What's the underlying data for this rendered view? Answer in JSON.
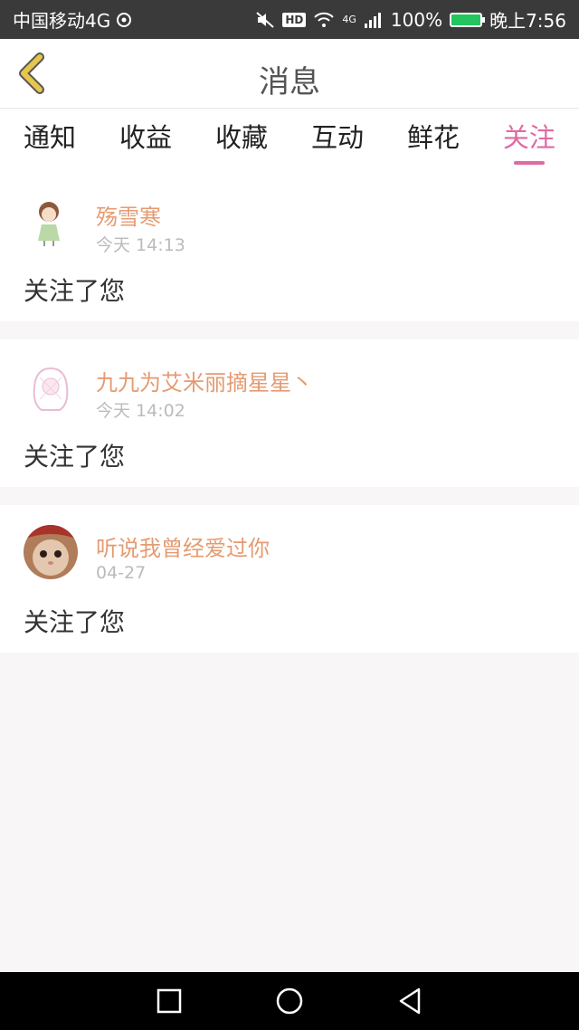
{
  "statusbar": {
    "carrier": "中国移动4G",
    "signal_tag": "4G",
    "battery": "100%",
    "time": "晚上7:56",
    "hd": "HD"
  },
  "header": {
    "title": "消息"
  },
  "tabs": [
    {
      "label": "通知"
    },
    {
      "label": "收益"
    },
    {
      "label": "收藏"
    },
    {
      "label": "互动"
    },
    {
      "label": "鲜花"
    },
    {
      "label": "关注"
    }
  ],
  "active_tab": "关注",
  "messages": [
    {
      "name": "殇雪寒",
      "time": "今天 14:13",
      "text": "关注了您"
    },
    {
      "name": "九九为艾米丽摘星星丶",
      "time": "今天 14:02",
      "text": "关注了您"
    },
    {
      "name": "听说我曾经爱过你",
      "time": "04-27",
      "text": "关注了您"
    }
  ],
  "colors": {
    "accent": "#e06aa3",
    "name": "#e59b72",
    "back_icon": "#e7c64a"
  }
}
